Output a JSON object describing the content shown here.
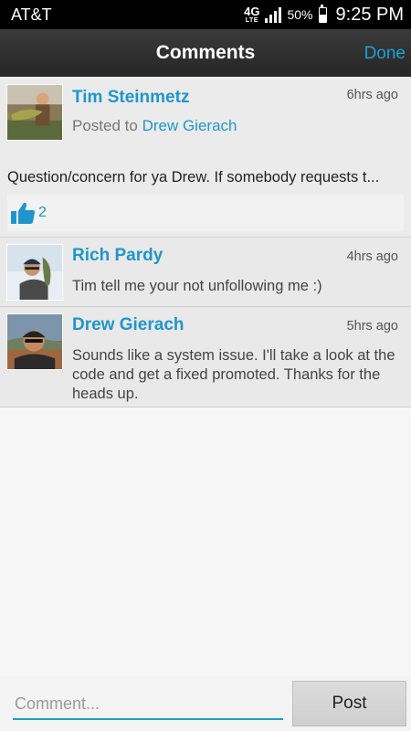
{
  "status_bar": {
    "carrier": "AT&T",
    "network": "4G",
    "network_sub": "LTE",
    "signal_bars": 4,
    "battery_percent": "50%",
    "battery_level": 0.5,
    "time": "9:25 PM"
  },
  "header": {
    "title": "Comments",
    "done_label": "Done"
  },
  "post": {
    "author": "Tim Steinmetz",
    "time": "6hrs ago",
    "posted_to_prefix": "Posted to",
    "posted_to_name": "Drew Gierach",
    "text": "Question/concern for ya Drew. If somebody requests t...",
    "likes": "2",
    "like_icon": "thumbs-up-icon"
  },
  "comments": [
    {
      "author": "Rich Pardy",
      "time": "4hrs ago",
      "text": "Tim tell me your not unfollowing me :)"
    },
    {
      "author": "Drew Gierach",
      "time": "5hrs ago",
      "text": "Sounds like a system issue. I'll take a look at the code and get a fixed promoted. Thanks for the heads up."
    }
  ],
  "composer": {
    "placeholder": "Comment...",
    "value": "",
    "post_label": "Post"
  },
  "colors": {
    "accent": "#1e96cd",
    "header_bg": "#2f2f2f",
    "status_bg": "#000000"
  }
}
